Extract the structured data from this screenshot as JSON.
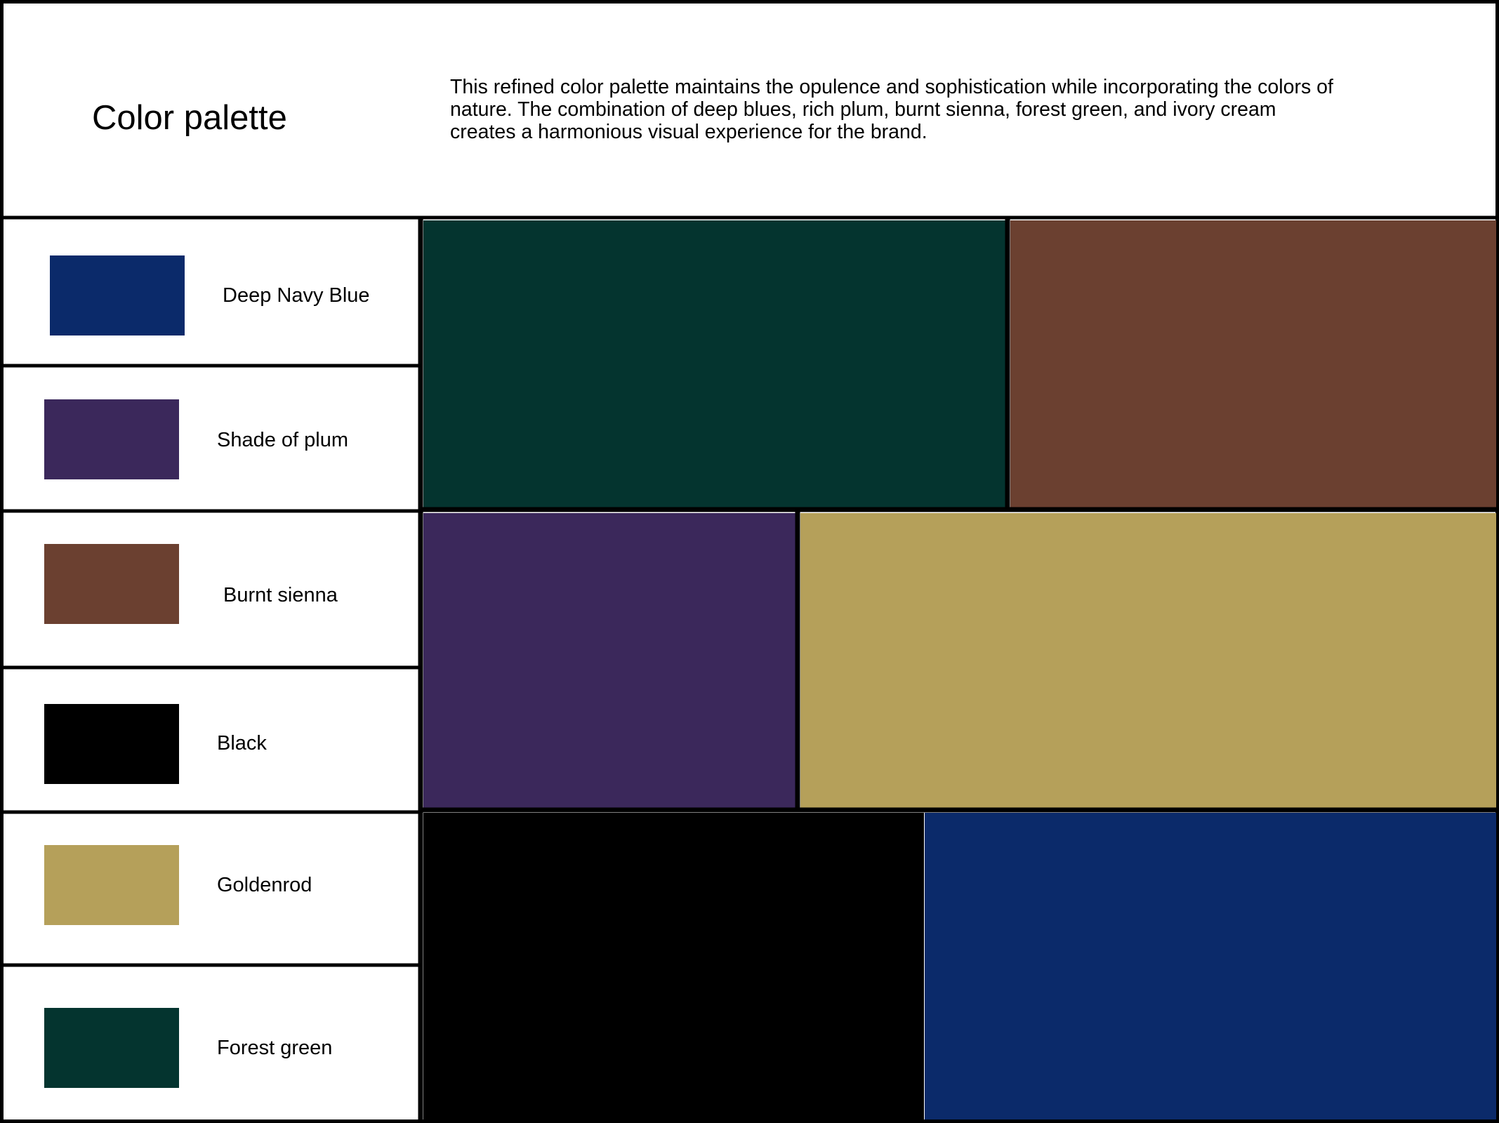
{
  "header": {
    "title": "Color palette",
    "description": "This refined color palette maintains the opulence and sophistication while incorporating the colors of nature. The combination of deep blues, rich plum, burnt sienna, forest green, and ivory cream creates a harmonious visual experience for the brand."
  },
  "swatches": [
    {
      "name": "Deep Navy Blue",
      "color": "#0b2a6a"
    },
    {
      "name": "Shade of plum",
      "color": "#3b285b"
    },
    {
      "name": "Burnt sienna",
      "color": "#6b4030"
    },
    {
      "name": "Black",
      "color": "#000000"
    },
    {
      "name": "Goldenrod",
      "color": "#b5a05a"
    },
    {
      "name": "Forest green",
      "color": "#04342f"
    }
  ],
  "mosaic": [
    {
      "color_name": "Forest green",
      "color": "#04342f"
    },
    {
      "color_name": "Burnt sienna",
      "color": "#6b4030"
    },
    {
      "color_name": "Shade of plum",
      "color": "#3b285b"
    },
    {
      "color_name": "Goldenrod",
      "color": "#b5a05a"
    },
    {
      "color_name": "Black",
      "color": "#000000"
    },
    {
      "color_name": "Deep Navy Blue",
      "color": "#0b2a6a"
    }
  ]
}
